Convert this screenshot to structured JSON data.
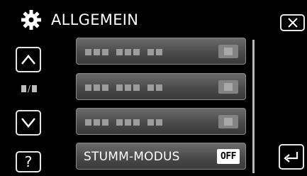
{
  "header": {
    "title": "ALLGEMEIN",
    "icon": "gear-icon"
  },
  "nav": {
    "up_icon": "chevron-up-icon",
    "down_icon": "chevron-down-icon",
    "page_indicator_icon": "page-indicator-icon",
    "help_label": "?",
    "close_icon": "close-icon",
    "back_icon": "back-arrow-icon"
  },
  "menu": {
    "items": [
      {
        "label": "",
        "value": ""
      },
      {
        "label": "",
        "value": ""
      },
      {
        "label": "",
        "value": ""
      },
      {
        "label": "STUMM-MODUS",
        "value": "OFF"
      }
    ]
  },
  "colors": {
    "background": "#000000",
    "item_top": "#6b6b6b",
    "item_bottom": "#3a3a3a",
    "border": "#e6e6e6"
  }
}
